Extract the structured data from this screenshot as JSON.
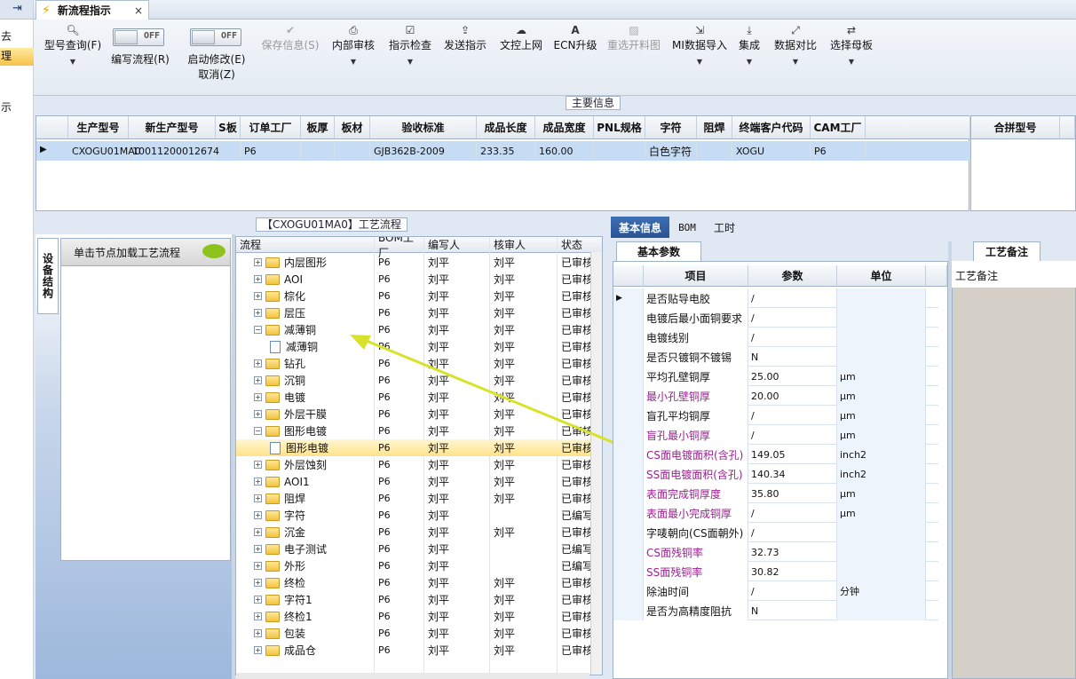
{
  "left_strip": {
    "items": [
      "去",
      "理",
      "示"
    ]
  },
  "tabbar": {
    "tab_title": "新流程指示",
    "close_glyph": "×"
  },
  "toolbar": {
    "model_query": "型号查询(F)",
    "edit_flow": "编写流程(R)",
    "start_edit": "启动修改(E)",
    "cancel": "取消(Z)",
    "toggle_off": "OFF",
    "save_info": "保存信息(S)",
    "internal_review": "内部审核",
    "instruction_check": "指示检查",
    "send_instruction": "发送指示",
    "upload_file": "文控上网",
    "ecn_upgrade": "ECN升级",
    "reselect_panel": "重选开料图",
    "mi_import": "MI数据导入",
    "integrate": "集成",
    "data_compare": "数据对比",
    "select_mother": "选择母板"
  },
  "main_info": {
    "label": "主要信息",
    "columns": [
      "生产型号",
      "新生产型号",
      "S板",
      "订单工厂",
      "板厚",
      "板材",
      "验收标准",
      "成品长度",
      "成品宽度",
      "PNL规格",
      "字符",
      "阻焊",
      "终端客户代码",
      "CAM工厂"
    ],
    "row": [
      "CXOGU01MA0",
      "10011200012674",
      "",
      "P6",
      "",
      "",
      "GJB362B-2009",
      "233.35",
      "160.00",
      "",
      "白色字符",
      "",
      "XOGU",
      "P6"
    ],
    "combine_header": "合拼型号"
  },
  "left_panel": {
    "vertical_tab": "设备结构",
    "header": "单击节点加载工艺流程"
  },
  "process_tree": {
    "label": "【CXOGU01MA0】工艺流程",
    "columns": [
      "流程",
      "BOM工厂",
      "编写人",
      "核审人",
      "状态"
    ],
    "rows": [
      {
        "name": "内层图形",
        "bom": "P6",
        "writer": "刘平",
        "reviewer": "刘平",
        "status": "已审核",
        "type": "folder"
      },
      {
        "name": "AOI",
        "bom": "P6",
        "writer": "刘平",
        "reviewer": "刘平",
        "status": "已审核",
        "type": "folder"
      },
      {
        "name": "棕化",
        "bom": "P6",
        "writer": "刘平",
        "reviewer": "刘平",
        "status": "已审核",
        "type": "folder"
      },
      {
        "name": "层压",
        "bom": "P6",
        "writer": "刘平",
        "reviewer": "刘平",
        "status": "已审核",
        "type": "folder"
      },
      {
        "name": "减薄铜",
        "bom": "P6",
        "writer": "刘平",
        "reviewer": "刘平",
        "status": "已审核",
        "type": "open"
      },
      {
        "name": "减薄铜",
        "bom": "P6",
        "writer": "刘平",
        "reviewer": "刘平",
        "status": "已审核",
        "type": "doc"
      },
      {
        "name": "钻孔",
        "bom": "P6",
        "writer": "刘平",
        "reviewer": "刘平",
        "status": "已审核",
        "type": "folder"
      },
      {
        "name": "沉铜",
        "bom": "P6",
        "writer": "刘平",
        "reviewer": "刘平",
        "status": "已审核",
        "type": "folder"
      },
      {
        "name": "电镀",
        "bom": "P6",
        "writer": "刘平",
        "reviewer": "刘平",
        "status": "已审核",
        "type": "folder"
      },
      {
        "name": "外层干膜",
        "bom": "P6",
        "writer": "刘平",
        "reviewer": "刘平",
        "status": "已审核",
        "type": "folder"
      },
      {
        "name": "图形电镀",
        "bom": "P6",
        "writer": "刘平",
        "reviewer": "刘平",
        "status": "已审核",
        "type": "open"
      },
      {
        "name": "图形电镀",
        "bom": "P6",
        "writer": "刘平",
        "reviewer": "刘平",
        "status": "已审核",
        "type": "doc"
      },
      {
        "name": "外层蚀刻",
        "bom": "P6",
        "writer": "刘平",
        "reviewer": "刘平",
        "status": "已审核",
        "type": "folder"
      },
      {
        "name": "AOI1",
        "bom": "P6",
        "writer": "刘平",
        "reviewer": "刘平",
        "status": "已审核",
        "type": "folder"
      },
      {
        "name": "阻焊",
        "bom": "P6",
        "writer": "刘平",
        "reviewer": "刘平",
        "status": "已审核",
        "type": "folder"
      },
      {
        "name": "字符",
        "bom": "P6",
        "writer": "刘平",
        "reviewer": "",
        "status": "已编写",
        "type": "folder"
      },
      {
        "name": "沉金",
        "bom": "P6",
        "writer": "刘平",
        "reviewer": "刘平",
        "status": "已审核",
        "type": "folder"
      },
      {
        "name": "电子测试",
        "bom": "P6",
        "writer": "刘平",
        "reviewer": "",
        "status": "已编写",
        "type": "folder"
      },
      {
        "name": "外形",
        "bom": "P6",
        "writer": "刘平",
        "reviewer": "",
        "status": "已编写",
        "type": "folder"
      },
      {
        "name": "终检",
        "bom": "P6",
        "writer": "刘平",
        "reviewer": "刘平",
        "status": "已审核",
        "type": "folder"
      },
      {
        "name": "字符1",
        "bom": "P6",
        "writer": "刘平",
        "reviewer": "刘平",
        "status": "已审核",
        "type": "folder"
      },
      {
        "name": "终检1",
        "bom": "P6",
        "writer": "刘平",
        "reviewer": "刘平",
        "status": "已审核",
        "type": "folder"
      },
      {
        "name": "包装",
        "bom": "P6",
        "writer": "刘平",
        "reviewer": "刘平",
        "status": "已审核",
        "type": "folder"
      },
      {
        "name": "成品仓",
        "bom": "P6",
        "writer": "刘平",
        "reviewer": "刘平",
        "status": "已审核",
        "type": "folder"
      }
    ]
  },
  "right_tabs": {
    "basic": "基本信息",
    "bom": "BOM",
    "hours": "工时"
  },
  "basic_params": {
    "tab": "基本参数",
    "columns": [
      "项目",
      "参数",
      "单位"
    ],
    "rows": [
      {
        "item": "是否贴导电胶",
        "param": "/",
        "unit": "",
        "mag": false
      },
      {
        "item": "电镀后最小面铜要求",
        "param": "/",
        "unit": "",
        "mag": false
      },
      {
        "item": "电镀线别",
        "param": "/",
        "unit": "",
        "mag": false
      },
      {
        "item": "是否只镀铜不镀锡",
        "param": "N",
        "unit": "",
        "mag": false
      },
      {
        "item": "平均孔壁铜厚",
        "param": "25.00",
        "unit": "μm",
        "mag": false
      },
      {
        "item": "最小孔壁铜厚",
        "param": "20.00",
        "unit": "μm",
        "mag": true
      },
      {
        "item": "盲孔平均铜厚",
        "param": "/",
        "unit": "μm",
        "mag": false
      },
      {
        "item": "盲孔最小铜厚",
        "param": "/",
        "unit": "μm",
        "mag": true
      },
      {
        "item": "CS面电镀面积(含孔)",
        "param": "149.05",
        "unit": "inch2",
        "mag": true
      },
      {
        "item": "SS面电镀面积(含孔)",
        "param": "140.34",
        "unit": "inch2",
        "mag": true
      },
      {
        "item": "表面完成铜厚度",
        "param": "35.80",
        "unit": "μm",
        "mag": true
      },
      {
        "item": "表面最小完成铜厚",
        "param": "/",
        "unit": "μm",
        "mag": true
      },
      {
        "item": "字唛朝向(CS面朝外)",
        "param": "/",
        "unit": "",
        "mag": false
      },
      {
        "item": "CS面残铜率",
        "param": "32.73",
        "unit": "",
        "mag": true
      },
      {
        "item": "SS面残铜率",
        "param": "30.82",
        "unit": "",
        "mag": true
      },
      {
        "item": "除油时间",
        "param": "/",
        "unit": "分钟",
        "mag": false
      },
      {
        "item": "是否为高精度阻抗",
        "param": "N",
        "unit": "",
        "mag": false
      }
    ]
  },
  "notes": {
    "tab": "工艺备注",
    "label": "工艺备注"
  },
  "colors": {
    "accent_tab": "#2a5393",
    "highlight_row": "#ffe28a",
    "selected_grid_row": "#c6dcf4",
    "annotation_arrow": "#e8ef2a"
  }
}
